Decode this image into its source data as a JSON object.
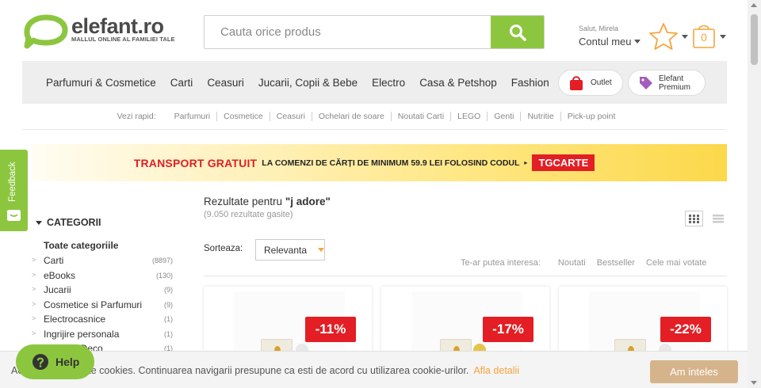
{
  "brand": {
    "name": "elefant.ro",
    "tagline": "MALLUL ONLINE AL FAMILIEI TALE",
    "logo_icon": "elefant-logo-icon",
    "green": "#8cc63f",
    "orange": "#f7a43a",
    "red": "#e31e24"
  },
  "search": {
    "placeholder": "Cauta orice produs",
    "value": "",
    "button_icon": "search-icon"
  },
  "account": {
    "greeting": "Salut, Mirela",
    "label": "Contul meu",
    "wishlist_icon": "star-icon",
    "cart_icon": "cart-icon",
    "cart_count": "0"
  },
  "nav": {
    "items": [
      {
        "label": "Parfumuri & Cosmetice"
      },
      {
        "label": "Carti"
      },
      {
        "label": "Ceasuri"
      },
      {
        "label": "Jucarii, Copii & Bebe"
      },
      {
        "label": "Electro"
      },
      {
        "label": "Casa & Petshop"
      },
      {
        "label": "Fashion"
      }
    ],
    "outlet_label": "Outlet",
    "premium_label_1": "Elefant",
    "premium_label_2": "Premium"
  },
  "quick_links": {
    "label": "Vezi rapid:",
    "items": [
      "Parfumuri",
      "Cosmetice",
      "Ceasuri",
      "Ochelari de soare",
      "Noutati Carti",
      "LEGO",
      "Genti",
      "Nutritie",
      "Pick-up point"
    ]
  },
  "banner": {
    "strong": "TRANSPORT GRATUIT",
    "text": "LA COMENZI DE CĂRȚI DE MINIMUM 59.9 LEI FOLOSIND CODUL",
    "arrow": "▸",
    "code": "TGCARTE"
  },
  "feedback": {
    "label": "Feedback"
  },
  "categories": {
    "title": "CATEGORII",
    "all": "Toate categoriile",
    "items": [
      {
        "name": "Carti",
        "count": "(8897)"
      },
      {
        "name": "eBooks",
        "count": "(130)"
      },
      {
        "name": "Jucarii",
        "count": "(9)"
      },
      {
        "name": "Cosmetice si Parfumuri",
        "count": "(9)"
      },
      {
        "name": "Electrocasnice",
        "count": "(1)"
      },
      {
        "name": "Ingrijire personala",
        "count": "(1)"
      },
      {
        "name": "Home & Deco",
        "count": "(1)"
      }
    ]
  },
  "results": {
    "prefix": "Rezultate pentru",
    "query": "\"j adore\"",
    "count": "(9.050 rezultate gasite)"
  },
  "sort": {
    "label": "Sorteaza:",
    "selected": "Relevanta"
  },
  "interest": {
    "label": "Te-ar putea interesa:",
    "options": [
      "Noutati",
      "Bestseller",
      "Cele mai votate"
    ]
  },
  "products": [
    {
      "discount": "-11%"
    },
    {
      "discount": "-17%"
    },
    {
      "discount": "-22%"
    }
  ],
  "cookie": {
    "text": "Acest site foloseste cookies. Continuarea navigarii presupune ca esti de acord cu utilizarea cookie-urilor.",
    "link": "Afla detalii",
    "button": "Am inteles"
  },
  "help": {
    "label": "Help"
  }
}
